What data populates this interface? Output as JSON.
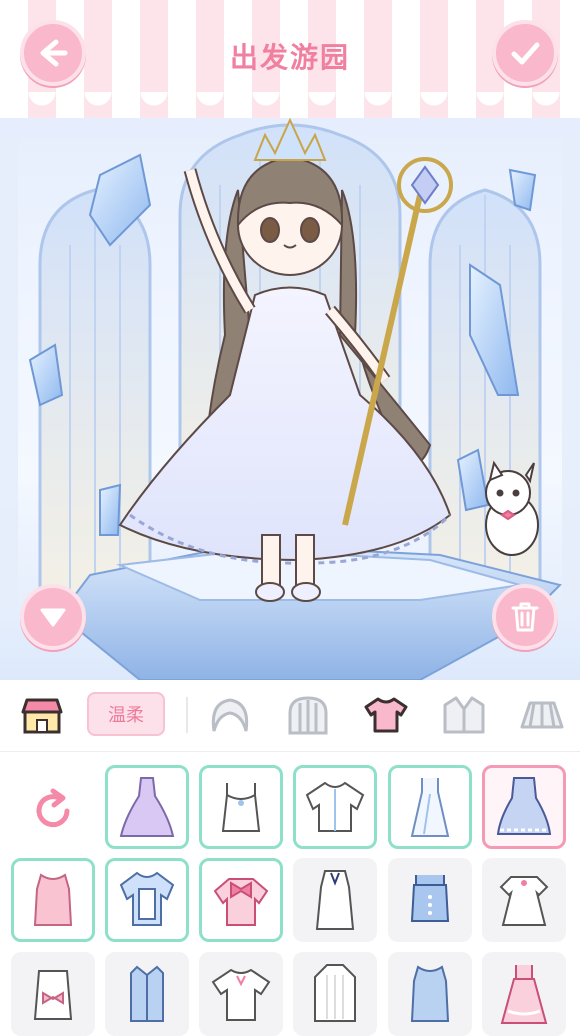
{
  "header": {
    "title": "出发游园",
    "back_icon": "arrow-left-icon",
    "confirm_icon": "check-icon"
  },
  "stage": {
    "collapse_icon": "triangle-down-icon",
    "delete_icon": "trash-icon"
  },
  "category_bar": {
    "shop_icon": "shop-icon",
    "style_tag": "温柔",
    "categories": [
      "hair-front",
      "hair-back",
      "top",
      "coat",
      "skirt"
    ],
    "active": "top"
  },
  "items_grid": {
    "reset_icon": "refresh-icon",
    "rows": [
      [
        "purple-gown",
        "white-camisole",
        "white-blouse",
        "blue-slip-dress",
        "navy-ruffle-dress"
      ],
      [
        "pink-tank",
        "blue-layered-top",
        "pink-bow-top",
        "white-button-dress",
        "blue-corset-top",
        "white-puff-dress"
      ],
      [
        "white-ribbon-top",
        "blue-shirt",
        "white-tee",
        "white-knit",
        "blue-tank",
        "pink-pinafore"
      ]
    ],
    "owned": [
      "purple-gown",
      "white-camisole",
      "white-blouse",
      "blue-slip-dress",
      "pink-tank",
      "blue-layered-top",
      "pink-bow-top"
    ],
    "selected": "navy-ruffle-dress"
  },
  "colors": {
    "accent_pink": "#f9b8cb",
    "owned_border": "#8ee0c9",
    "selected_border": "#f59ab5"
  }
}
